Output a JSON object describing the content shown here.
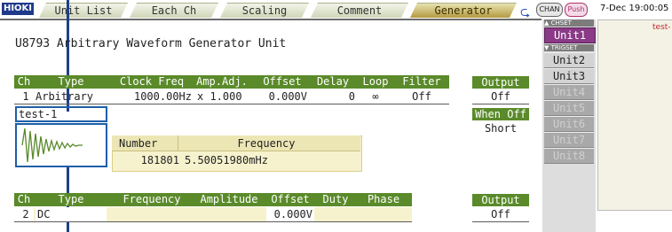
{
  "top_bar": {
    "logo": "HIOKI",
    "tabs": [
      "Unit List",
      "Each Ch",
      "Scaling",
      "Comment",
      "Generator"
    ],
    "active_tab": "Generator",
    "chan_pill": "CHAN",
    "push_pill": "Push",
    "datetime": "7-Dec 19:00:05"
  },
  "page_title": "U8793  Arbitrary Waveform Generator Unit",
  "gen_table": {
    "headers": [
      "Ch",
      "Type",
      "Clock Freq",
      "Amp.Adj.",
      "Offset",
      "Delay",
      "Loop",
      "Filter"
    ],
    "row": {
      "ch": "1",
      "type": "Arbitrary",
      "clock_freq": "1000.00Hz",
      "amp_adj": "x 1.000",
      "offset": "0.000V",
      "delay": "0",
      "loop": "∞",
      "filter": "Off"
    },
    "waveform_name": "test-1"
  },
  "output1": {
    "header": "Output",
    "value": "Off",
    "when_off_label": "When Off",
    "when_off_value": "Short"
  },
  "info": {
    "headers": [
      "Number",
      "Frequency"
    ],
    "number": "181801",
    "frequency": "5.50051980mHz"
  },
  "fg_table": {
    "headers": [
      "Ch",
      "Type",
      "Frequency",
      "Amplitude",
      "Offset",
      "Duty",
      "Phase"
    ],
    "row": {
      "ch": "2",
      "type": "DC",
      "frequency": "",
      "amplitude": "",
      "offset": "0.000V",
      "duty": "",
      "phase": ""
    }
  },
  "output2": {
    "header": "Output",
    "value": "Off"
  },
  "unit_panel": {
    "chset_label": "CHSET",
    "trigset_label": "TRIGSET",
    "units": [
      "Unit1",
      "Unit2",
      "Unit3",
      "Unit4",
      "Unit5",
      "Unit6",
      "Unit7",
      "Unit8"
    ],
    "selected": "Unit1"
  },
  "right_preview_text": "test-",
  "colors": {
    "header_green": "#5a8a2a",
    "callout_blue": "#1f5fa8",
    "selected_unit": "#8a3a86"
  }
}
